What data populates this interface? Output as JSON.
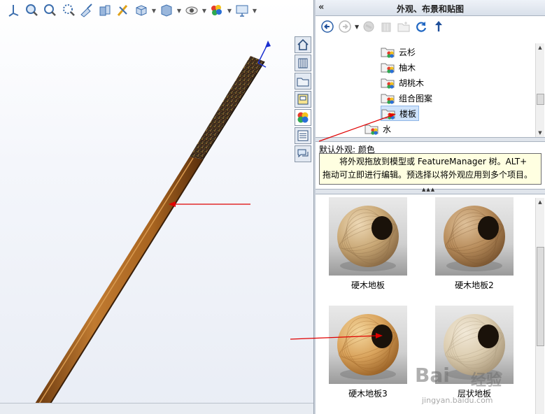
{
  "viewport": {
    "toolbar": {
      "buttons": [
        {
          "name": "view-orientation-icon",
          "dropdown": false
        },
        {
          "name": "zoom-to-fit-icon",
          "dropdown": false
        },
        {
          "name": "zoom-to-area-icon",
          "dropdown": false
        },
        {
          "name": "previous-view-icon",
          "dropdown": false
        },
        {
          "name": "section-view-icon",
          "dropdown": false
        },
        {
          "name": "dynamic-annotation-icon",
          "dropdown": false
        },
        {
          "name": "display-style-icon",
          "dropdown": false
        },
        {
          "name": "hide-show-items-icon",
          "dropdown": true
        },
        {
          "name": "view-settings-icon",
          "dropdown": true
        },
        {
          "name": "appearance-icon",
          "dropdown": true
        },
        {
          "name": "scene-icon",
          "dropdown": true
        },
        {
          "name": "monitor-icon",
          "dropdown": true
        }
      ]
    },
    "model": {
      "rod_color": "#a86420",
      "rod_dark": "#6b3a10",
      "textured_color": "#3a2a1a"
    }
  },
  "panel": {
    "title": "外观、布景和贴图",
    "collapse_symbol": "«",
    "side_tabs": [
      {
        "name": "home-tab-icon"
      },
      {
        "name": "design-library-tab-icon"
      },
      {
        "name": "file-explorer-tab-icon"
      },
      {
        "name": "view-palette-tab-icon"
      },
      {
        "name": "appearances-tab-icon"
      },
      {
        "name": "custom-properties-tab-icon"
      },
      {
        "name": "forum-tab-icon"
      }
    ],
    "tree": {
      "items": [
        {
          "label": "云杉",
          "selected": false
        },
        {
          "label": "柚木",
          "selected": false
        },
        {
          "label": "胡桃木",
          "selected": false
        },
        {
          "label": "组合图案",
          "selected": false
        },
        {
          "label": "楼板",
          "selected": true
        },
        {
          "label": "水",
          "selected": false
        }
      ]
    },
    "default_appearance": "默认外观: 颜色",
    "tooltip": {
      "line1": "将外观拖放到模型或 FeatureManager 树。ALT+",
      "line2": "拖动可立即进行编辑。预选择以将外观应用到多个项目。"
    },
    "thumbnails": [
      {
        "label": "硬木地板",
        "base": "#c9a876",
        "highlight": "#eed9b6",
        "dark": "#8a6a44"
      },
      {
        "label": "硬木地板2",
        "base": "#b88d5c",
        "highlight": "#dfc19a",
        "dark": "#7a5530"
      },
      {
        "label": "硬木地板3",
        "base": "#d9a35c",
        "highlight": "#f4d79e",
        "dark": "#9a6226"
      },
      {
        "label": "层状地板",
        "base": "#dccdb0",
        "highlight": "#f2e9d8",
        "dark": "#a9977a"
      }
    ]
  },
  "watermark": {
    "logo": "Bai",
    "logo2": "经验",
    "url": "jingyan.baidu.com"
  },
  "accent": "#e00000"
}
